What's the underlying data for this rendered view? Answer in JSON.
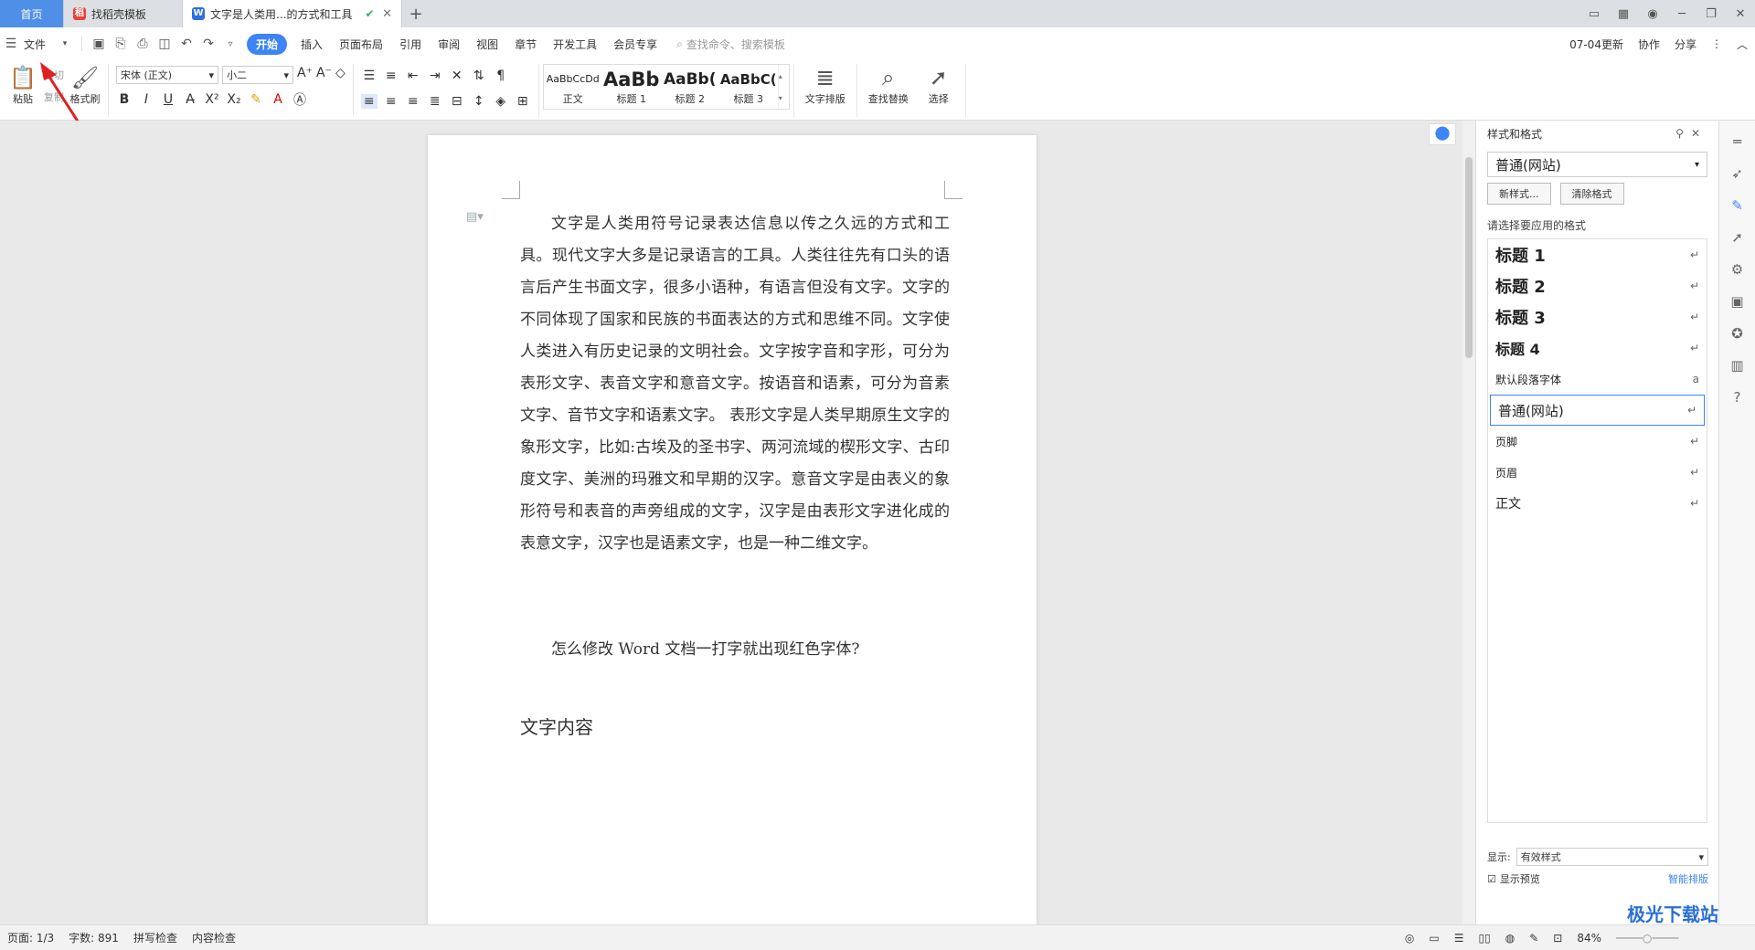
{
  "tabs": {
    "home": "首页",
    "template": "找稻壳模板",
    "doc": "文字是人类用...的方式和工具"
  },
  "menu": {
    "file": "文件",
    "items": [
      "开始",
      "插入",
      "页面布局",
      "引用",
      "审阅",
      "视图",
      "章节",
      "开发工具",
      "会员专享"
    ],
    "search": "查找命令、搜索模板",
    "update": "07-04更新",
    "collab": "协作",
    "share": "分享"
  },
  "ribbon": {
    "paste": "粘贴",
    "cut": "剪切",
    "copy": "复制",
    "format_painter": "格式刷",
    "font": "宋体 (正文)",
    "size": "小二",
    "styles": [
      {
        "preview": "AaBbCcDd",
        "label": "正文"
      },
      {
        "preview": "AaBb",
        "label": "标题 1"
      },
      {
        "preview": "AaBb(",
        "label": "标题 2"
      },
      {
        "preview": "AaBbC(",
        "label": "标题 3"
      }
    ],
    "text_layout": "文字排版",
    "find_replace": "查找替换",
    "select": "选择"
  },
  "doc": {
    "body": "文字是人类用符号记录表达信息以传之久远的方式和工具。现代文字大多是记录语言的工具。人类往往先有口头的语言后产生书面文字，很多小语种，有语言但没有文字。文字的不同体现了国家和民族的书面表达的方式和思维不同。文字使人类进入有历史记录的文明社会。文字按字音和字形，可分为表形文字、表音文字和意音文字。按语音和语素，可分为音素文字、音节文字和语素文字。 表形文字是人类早期原生文字的象形文字，比如:古埃及的圣书字、两河流域的楔形文字、古印度文字、美洲的玛雅文和早期的汉字。意音文字是由表义的象形符号和表音的声旁组成的文字，汉字是由表形文字进化成的表意文字，汉字也是语素文字，也是一种二维文字。",
    "question": "怎么修改 Word 文档一打字就出现红色字体?",
    "heading": "文字内容"
  },
  "panel": {
    "title": "样式和格式",
    "current": "普通(网站)",
    "new_style": "新样式...",
    "clear": "清除格式",
    "choose_label": "请选择要应用的格式",
    "styles": [
      {
        "name": "标题  1",
        "bold": true,
        "mark": "↵"
      },
      {
        "name": "标题  2",
        "bold": true,
        "mark": "↵"
      },
      {
        "name": "标题  3",
        "bold": true,
        "mark": "↵"
      },
      {
        "name": "标题  4",
        "bold": true,
        "mark": "↵"
      },
      {
        "name": "默认段落字体",
        "bold": false,
        "mark": "a"
      },
      {
        "name": "普通(网站)",
        "bold": false,
        "mark": "↵"
      },
      {
        "name": "页脚",
        "bold": false,
        "mark": "↵"
      },
      {
        "name": "页眉",
        "bold": false,
        "mark": "↵"
      },
      {
        "name": "正文",
        "bold": false,
        "mark": "↵"
      }
    ],
    "show_label": "显示:",
    "show_value": "有效样式",
    "preview_label": "显示预览",
    "smart": "智能排版"
  },
  "status": {
    "page": "页面: 1/3",
    "words": "字数: 891",
    "spell": "拼写检查",
    "content": "内容检查",
    "zoom": "84%"
  },
  "watermark": "极光下载站"
}
